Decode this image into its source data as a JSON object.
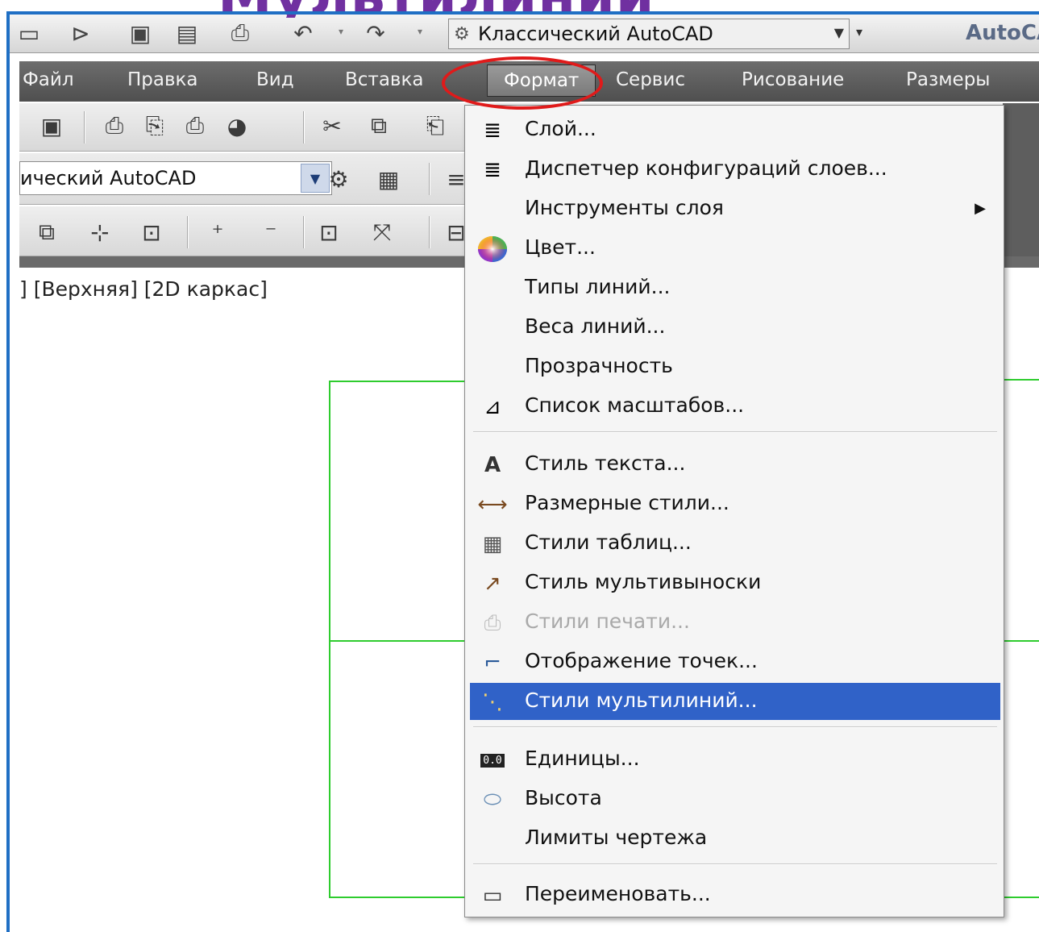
{
  "slide_title": "Мультилинии",
  "qat": {
    "workspace": "Классический AutoCAD",
    "app_title": "AutoCA"
  },
  "menubar": {
    "items": [
      "Файл",
      "Правка",
      "Вид",
      "Вставка",
      "Формат",
      "Сервис",
      "Рисование",
      "Размеры"
    ],
    "active": "Формат"
  },
  "toolbar": {
    "workspace_combo": "ический AutoCAD"
  },
  "viewport": {
    "label": "] [Верхняя] [2D каркас]"
  },
  "format_menu": {
    "items": [
      {
        "label": "Слой...",
        "icon": "layer-icon"
      },
      {
        "label": "Диспетчер конфигураций слоев...",
        "icon": "layer-states-icon"
      },
      {
        "label": "Инструменты слоя",
        "icon": "",
        "submenu": true
      },
      {
        "label": "Цвет...",
        "icon": "color-wheel-icon"
      },
      {
        "label": "Типы линий...",
        "icon": ""
      },
      {
        "label": "Веса линий...",
        "icon": ""
      },
      {
        "label": "Прозрачность",
        "icon": ""
      },
      {
        "label": "Список масштабов...",
        "icon": "scale-list-icon"
      },
      {
        "label": "Стиль текста...",
        "icon": "text-style-icon"
      },
      {
        "label": "Размерные стили...",
        "icon": "dim-style-icon"
      },
      {
        "label": "Стили таблиц...",
        "icon": "table-style-icon"
      },
      {
        "label": "Стиль мультивыноски",
        "icon": "mleader-style-icon"
      },
      {
        "label": "Стили печати...",
        "icon": "plot-style-icon",
        "disabled": true
      },
      {
        "label": "Отображение точек...",
        "icon": "point-style-icon"
      },
      {
        "label": "Стили мультилиний...",
        "icon": "mline-style-icon",
        "highlighted": true
      },
      {
        "label": "Единицы...",
        "icon": "units-icon"
      },
      {
        "label": "Высота",
        "icon": "thickness-icon"
      },
      {
        "label": "Лимиты чертежа",
        "icon": ""
      },
      {
        "label": "Переименовать...",
        "icon": "rename-icon"
      }
    ]
  },
  "colors": {
    "highlight": "#3062c8",
    "annotation_ellipse": "#e01a1a",
    "title": "#7030a0",
    "frame": "#1f6fc4",
    "drawing_lines": "#2ecc2e"
  }
}
